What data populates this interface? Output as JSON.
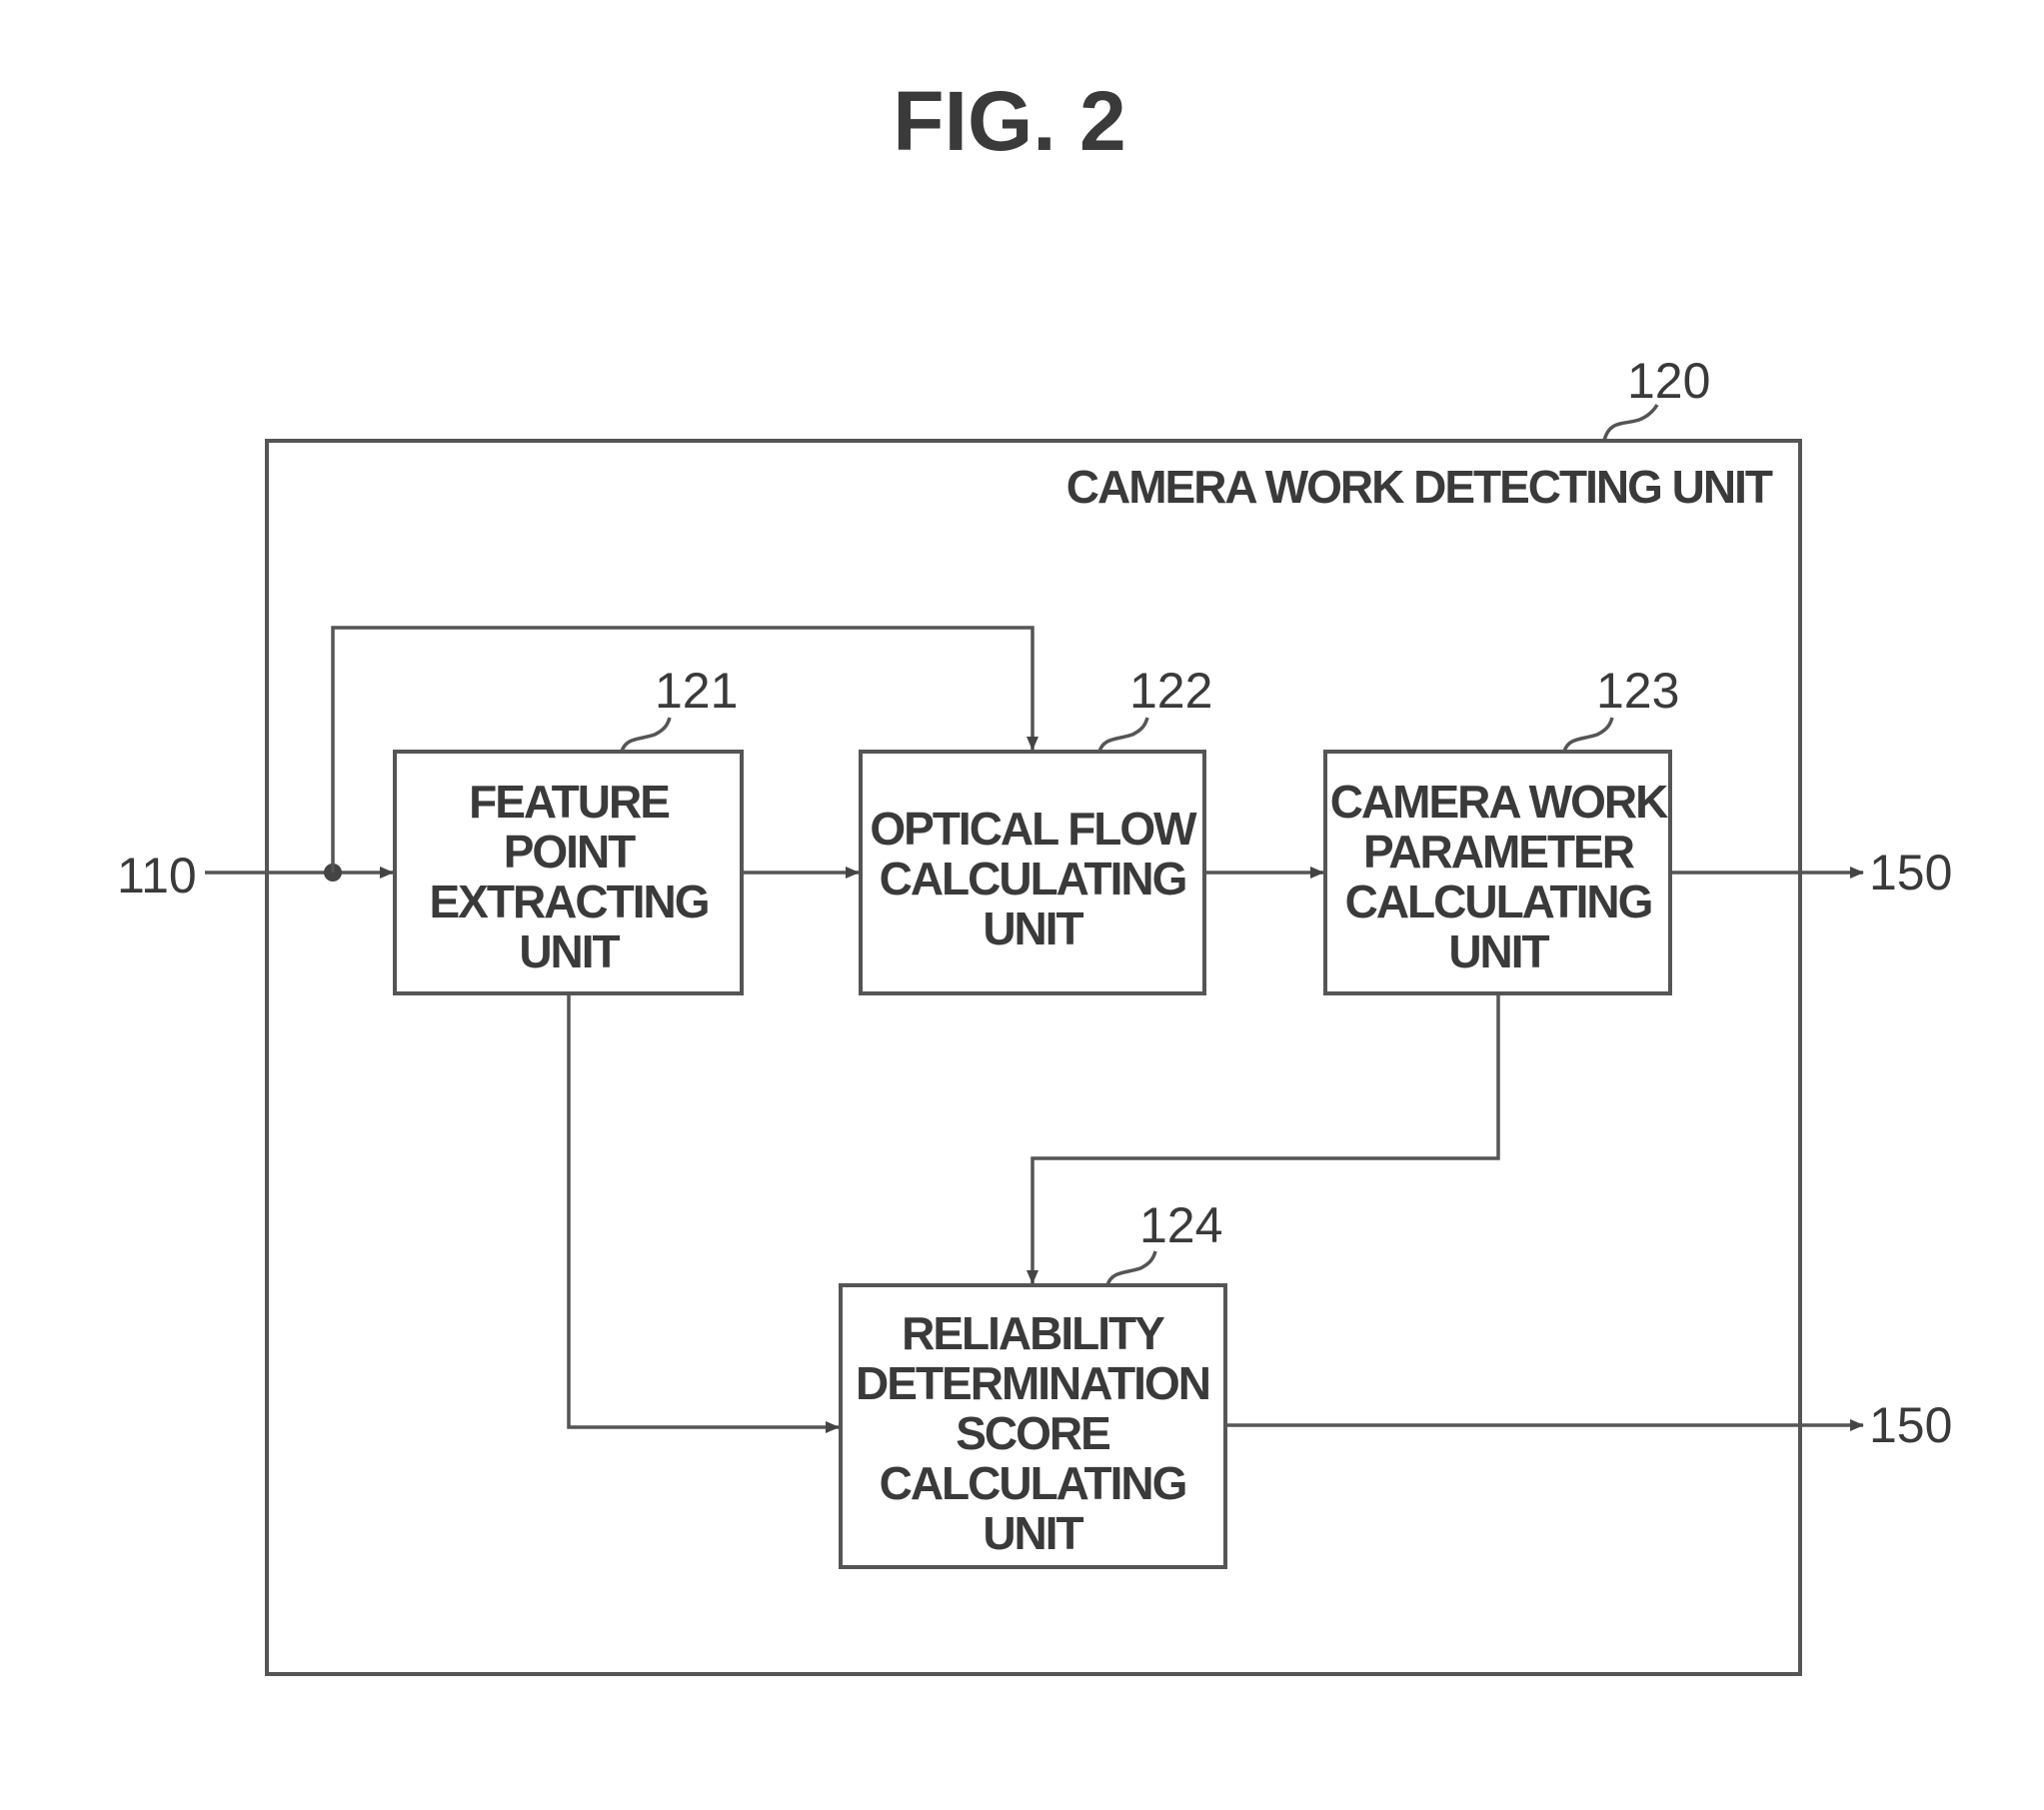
{
  "figure": {
    "title": "FIG. 2"
  },
  "container": {
    "ref": "120",
    "label": "CAMERA WORK DETECTING UNIT"
  },
  "blocks": [
    {
      "ref": "121",
      "lines": [
        "FEATURE",
        "POINT",
        "EXTRACTING",
        "UNIT"
      ]
    },
    {
      "ref": "122",
      "lines": [
        "OPTICAL FLOW",
        "CALCULATING",
        "UNIT"
      ]
    },
    {
      "ref": "123",
      "lines": [
        "CAMERA WORK",
        "PARAMETER",
        "CALCULATING",
        "UNIT"
      ]
    },
    {
      "ref": "124",
      "lines": [
        "RELIABILITY",
        "DETERMINATION",
        "SCORE",
        "CALCULATING",
        "UNIT"
      ]
    }
  ],
  "io": {
    "input_ref": "110",
    "output_ref_1": "150",
    "output_ref_2": "150"
  }
}
